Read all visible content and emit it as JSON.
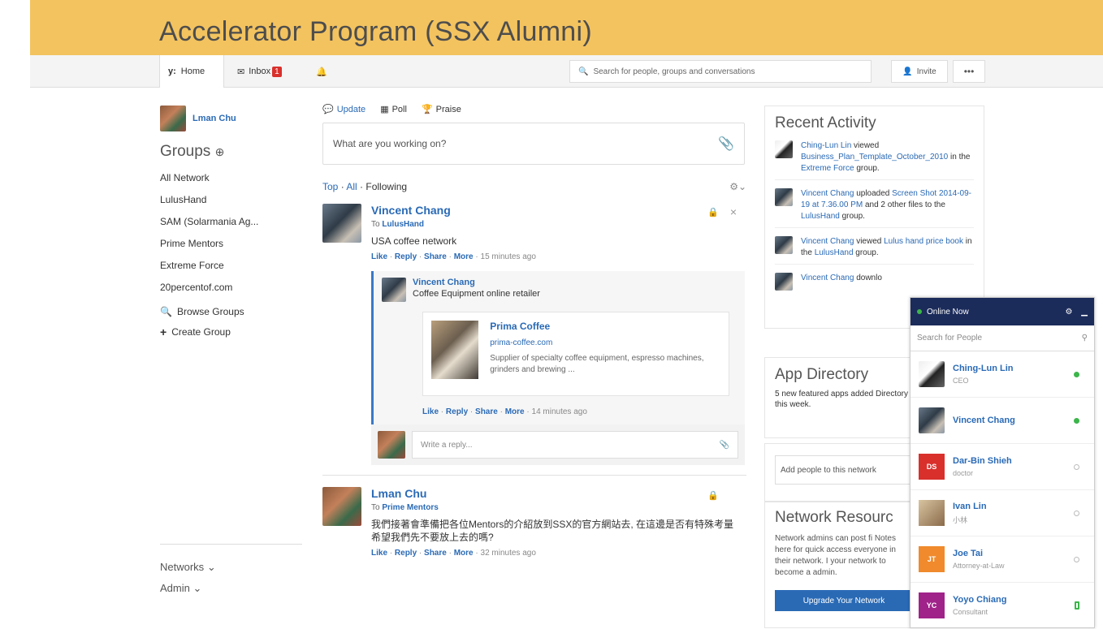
{
  "app_title": "Accelerator Program (SSX Alumni)",
  "nav": {
    "home_label": "Home",
    "inbox_label": "Inbox",
    "inbox_count": "1",
    "search_placeholder": "Search for people, groups and conversations",
    "invite_label": "Invite",
    "more_label": "•••"
  },
  "sidebar": {
    "user_name": "Lman Chu",
    "groups_heading": "Groups",
    "groups": [
      "All Network",
      "LulusHand",
      "SAM (Solarmania Ag...",
      "Prime Mentors",
      "Extreme Force",
      "20percentof.com"
    ],
    "browse_groups": "Browse Groups",
    "create_group": "Create Group",
    "networks_label": "Networks",
    "admin_label": "Admin"
  },
  "publisher": {
    "tab_update": "Update",
    "tab_poll": "Poll",
    "tab_praise": "Praise",
    "placeholder": "What are you working on?"
  },
  "feed_filter": {
    "top": "Top",
    "all": "All",
    "following": "Following"
  },
  "messages": [
    {
      "sender": "Vincent Chang",
      "to_prefix": "To",
      "to_group": "LulusHand",
      "body": "USA coffee network",
      "like": "Like",
      "reply": "Reply",
      "share": "Share",
      "more": "More",
      "time": "15 minutes ago",
      "reply_thread": {
        "sender": "Vincent Chang",
        "body": "Coffee Equipment online retailer",
        "card_title": "Prima Coffee",
        "card_url": "prima-coffee.com",
        "card_desc": "Supplier of specialty coffee equipment, espresso machines, grinders and brewing ...",
        "like": "Like",
        "reply": "Reply",
        "share": "Share",
        "more": "More",
        "time": "14 minutes ago"
      },
      "reply_placeholder": "Write a reply..."
    },
    {
      "sender": "Lman Chu",
      "to_prefix": "To",
      "to_group": "Prime Mentors",
      "body": "我們接著會準備把各位Mentors的介紹放到SSX的官方網站去, 在這邊是否有特殊考量希望我們先不要放上去的嗎?",
      "like": "Like",
      "reply": "Reply",
      "share": "Share",
      "more": "More",
      "time": "32 minutes ago"
    }
  ],
  "recent_activity": {
    "title": "Recent Activity",
    "items": [
      {
        "actor": "Ching-Lun Lin",
        "verb": "viewed",
        "object": "Business_Plan_Template_October_2010",
        "suffix_a": "in the",
        "group": "Extreme Force",
        "suffix_b": "group."
      },
      {
        "actor": "Vincent Chang",
        "verb": "uploaded",
        "object": "Screen Shot 2014-09-19 at 7.36.00 PM",
        "suffix_a": "and 2 other files to the",
        "group": "LulusHand",
        "suffix_b": "group."
      },
      {
        "actor": "Vincent Chang",
        "verb": "viewed",
        "object": "Lulus hand price book",
        "suffix_a": "in the",
        "group": "LulusHand",
        "suffix_b": "group."
      },
      {
        "actor": "Vincent Chang",
        "verb": "downlo",
        "object": "",
        "suffix_a": "",
        "group": "",
        "suffix_b": ""
      }
    ]
  },
  "app_directory": {
    "title": "App Directory",
    "text": "5 new featured apps added Directory this week."
  },
  "add_people_placeholder": "Add people to this network",
  "network_resources": {
    "title": "Network Resourc",
    "text": "Network admins can post fi Notes here for quick access everyone in their network. I your network to become a admin.",
    "button": "Upgrade Your Network"
  },
  "online_now": {
    "title": "Online Now",
    "search_placeholder": "Search for People",
    "people": [
      {
        "name": "Ching-Lun Lin",
        "role": "CEO",
        "initials": "",
        "color": "",
        "status": "online"
      },
      {
        "name": "Vincent Chang",
        "role": "",
        "initials": "",
        "color": "",
        "status": "online"
      },
      {
        "name": "Dar-Bin Shieh",
        "role": "doctor",
        "initials": "DS",
        "color": "#d9302c",
        "status": "offline"
      },
      {
        "name": "Ivan Lin",
        "role": "小林",
        "initials": "",
        "color": "",
        "status": "offline"
      },
      {
        "name": "Joe Tai",
        "role": "Attorney-at-Law",
        "initials": "JT",
        "color": "#f08a2c",
        "status": "offline"
      },
      {
        "name": "Yoyo Chiang",
        "role": "Consultant",
        "initials": "YC",
        "color": "#a0238a",
        "status": "mobile"
      }
    ]
  },
  "colors": {
    "banner": "#f3c35f",
    "link": "#2a6ab5",
    "online_header": "#1b2b5a"
  }
}
